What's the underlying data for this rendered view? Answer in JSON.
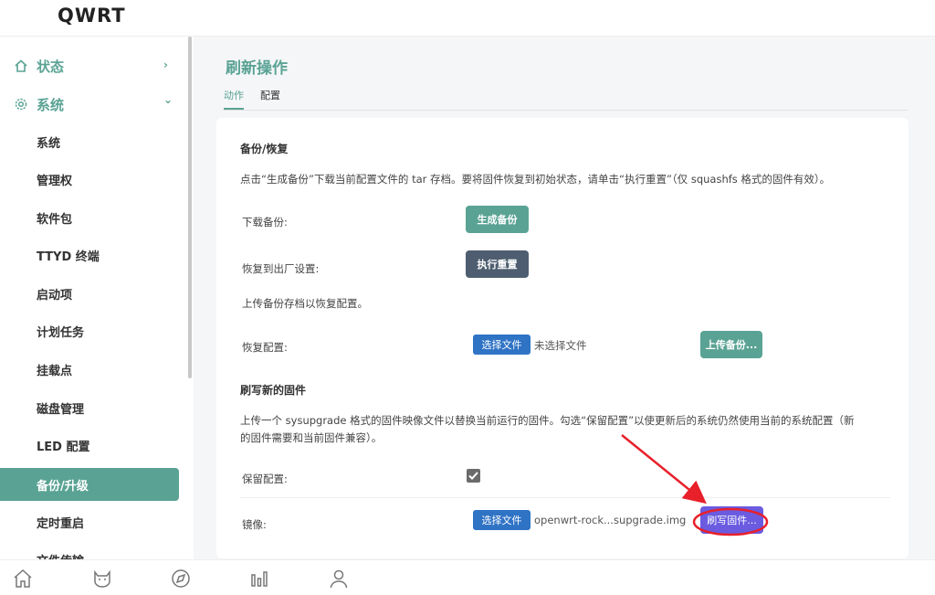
{
  "header": {
    "brand": "QWRT"
  },
  "sidebar": {
    "top_items": [
      {
        "label": "状态",
        "icon": "home-icon",
        "chevron": "›"
      },
      {
        "label": "系统",
        "icon": "gear-icon",
        "chevron": "⌄"
      }
    ],
    "items": [
      {
        "label": "系统"
      },
      {
        "label": "管理权"
      },
      {
        "label": "软件包"
      },
      {
        "label": "TTYD 终端"
      },
      {
        "label": "启动项"
      },
      {
        "label": "计划任务"
      },
      {
        "label": "挂载点"
      },
      {
        "label": "磁盘管理"
      },
      {
        "label": "LED 配置"
      },
      {
        "label": "备份/升级",
        "active": true
      },
      {
        "label": "定时重启"
      },
      {
        "label": "文件传输"
      }
    ]
  },
  "main": {
    "title": "刷新操作",
    "tabs": [
      {
        "label": "动作",
        "active": true
      },
      {
        "label": "配置"
      }
    ],
    "backup": {
      "title": "备份/恢复",
      "description": "点击“生成备份”下载当前配置文件的 tar 存档。要将固件恢复到初始状态，请单击“执行重置”（仅 squashfs 格式的固件有效）。",
      "download_label": "下载备份:",
      "generate_button": "生成备份",
      "reset_label": "恢复到出厂设置:",
      "reset_button": "执行重置",
      "upload_note": "上传备份存档以恢复配置。",
      "restore_label": "恢复配置:",
      "choose_file_button": "选择文件",
      "no_file_text": "未选择文件",
      "upload_button": "上传备份..."
    },
    "firmware": {
      "title": "刷写新的固件",
      "description_line1": "上传一个 sysupgrade 格式的固件映像文件以替换当前运行的固件。勾选“保留配置”以使更新后的系统仍然使用当前的系统配置（新",
      "description_line2": "的固件需要和当前固件兼容）。",
      "keep_config_label": "保留配置:",
      "keep_config_checked": true,
      "image_label": "镜像:",
      "choose_file_button": "选择文件",
      "file_name": "openwrt-rock...supgrade.img",
      "flash_button": "刷写固件..."
    }
  },
  "bottom_nav": [
    {
      "icon": "home-icon"
    },
    {
      "icon": "cat-icon"
    },
    {
      "icon": "compass-icon"
    },
    {
      "icon": "bar-chart-icon"
    },
    {
      "icon": "user-icon"
    }
  ],
  "colors": {
    "accent": "#5aa394",
    "slate": "#4e5e70",
    "blue": "#2f73c5",
    "purple": "#6a5be0",
    "annotation": "#e8202a"
  }
}
